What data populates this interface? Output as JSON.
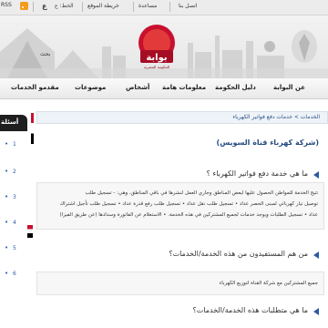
{
  "topbar": {
    "rss": "RSS",
    "font_icon": "ع",
    "font_size_label": "الخط: ع",
    "links": [
      "خريطة الموقع",
      "مساعدة",
      "اتصل بنا"
    ]
  },
  "header": {
    "search_label": "بحث",
    "logo_text": "بوابة",
    "logo_subtext": "الحكومة المصرية"
  },
  "nav": {
    "items": [
      "عن البوابة",
      "دليل الحكومة",
      "معلومات هامة",
      "أشخاص",
      "موضوعات",
      "مقدمو الخدمات"
    ]
  },
  "left": {
    "title": "أسئلة",
    "items": [
      "1",
      "2",
      "3",
      "4",
      "5",
      "6"
    ]
  },
  "breadcrumb": "الخدمات > خدمات دفع فواتير الكهرباء",
  "page_title": "(شركة كهرباء قناة السويس)",
  "sections": [
    {
      "question": "ما هي خدمة دفع فواتير الكهرباء ؟",
      "answer": [
        "تتيح الخدمة للمواطن الحصول عليها لبعض المناطق وجاري العمل لنشرها في باقي المناطق، وهي: - تسجيل طلب",
        "توصيل تيار كهربائي لمبنى الحصر عداد • تسجيل طلب نقل عداد • تسجيل طلب رفع قدرة عداد • تسجيل طلب تأجيل اشتراك",
        "عداد • تسجيل الطلبات ويوجد خدمات لجميع المشتركين في هذه الخدمة. • الاستعلام عن الفاتورة وسدادها (عن طريق الفيزا)"
      ]
    },
    {
      "question": "من هم المستفيدون من هذه الخدمة/الخدمات؟",
      "answer": [
        "جميع المشتركين مع شركة القناة لتوزيع الكهرباء"
      ]
    },
    {
      "question": "ما هي متطلبات هذه الخدمة/الخدمات؟",
      "answer": []
    }
  ],
  "colors": {
    "accent": "#c8102e",
    "link": "#234a82",
    "nav_bg": "#ececec"
  }
}
